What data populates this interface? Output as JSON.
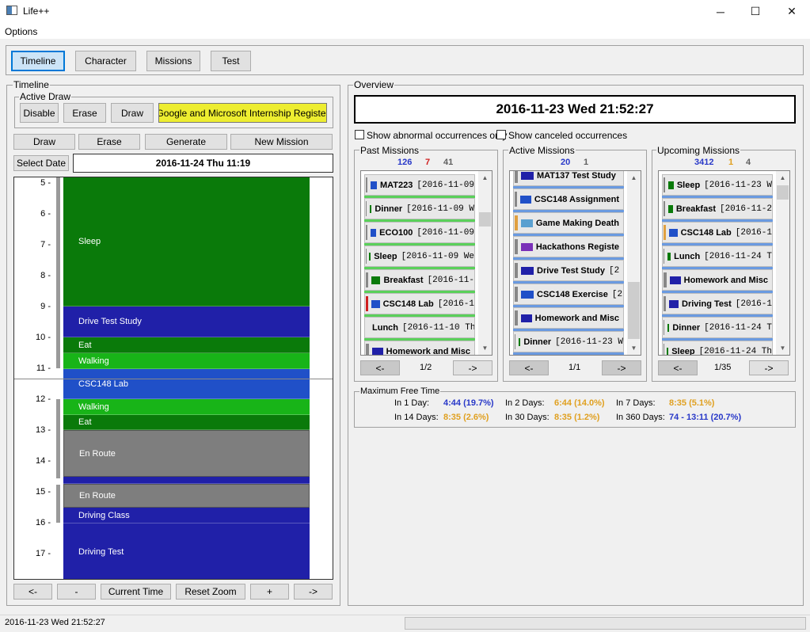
{
  "window": {
    "title": "Life++",
    "minimize": "─",
    "maximize": "☐",
    "close": "✕"
  },
  "menu": {
    "options": "Options"
  },
  "tabs": [
    "Timeline",
    "Character",
    "Missions",
    "Test"
  ],
  "timeline": {
    "group_label": "Timeline",
    "active_draw": {
      "label": "Active Draw",
      "disable": "Disable",
      "erase": "Erase",
      "draw": "Draw",
      "current_mission": "Google and Microsoft Internship Register"
    },
    "toolbar": {
      "draw": "Draw",
      "erase": "Erase",
      "generate": "Generate",
      "new_mission": "New Mission"
    },
    "select_date": "Select Date",
    "date_display": "2016-11-24 Thu 11:19",
    "hours": [
      "5 -",
      "6 -",
      "7 -",
      "8 -",
      "9 -",
      "10 -",
      "11 -",
      "12 -",
      "13 -",
      "14 -",
      "15 -",
      "16 -",
      "17 -"
    ],
    "blocks": [
      {
        "label": "Sleep",
        "color": "#0a7a0a"
      },
      {
        "label": "Drive Test Study",
        "color": "#2020a8"
      },
      {
        "label": "Eat",
        "color": "#0a7a0a"
      },
      {
        "label": "Walking",
        "color": "#18b418"
      },
      {
        "label": "CSC148 Lab",
        "color": "#2050c8"
      },
      {
        "label": "Walking",
        "color": "#18b418"
      },
      {
        "label": "Eat",
        "color": "#0a7a0a"
      },
      {
        "label": "En Route",
        "color": "#7e7e7e"
      },
      {
        "label": "",
        "color": "#2020a8"
      },
      {
        "label": "En Route",
        "color": "#7e7e7e"
      },
      {
        "label": "Driving Class",
        "color": "#2020a8"
      },
      {
        "label": "Driving Test",
        "color": "#2020a8"
      }
    ],
    "nav": {
      "prev": "<-",
      "zoom_out": "-",
      "current_time": "Current Time",
      "reset_zoom": "Reset Zoom",
      "zoom_in": "+",
      "next": "->"
    }
  },
  "overview": {
    "group_label": "Overview",
    "datetime": "2016-11-23 Wed 21:52:27",
    "show_abnormal": "Show abnormal occurrences only",
    "show_canceled": "Show canceled occurrences",
    "past": {
      "label": "Past Missions",
      "counts": [
        "126",
        "7",
        "41"
      ],
      "page": "1/2",
      "prev": "<-",
      "next": "->",
      "items": [
        {
          "name": "MAT223",
          "date": "[2016-11-09",
          "color": "#2050c8",
          "bar": "#888888",
          "progress": "#5ad05a"
        },
        {
          "name": "Dinner",
          "date": "[2016-11-09 W",
          "color": "#0a7a0a",
          "bar": "#888888",
          "progress": "#5ad05a"
        },
        {
          "name": "ECO100",
          "date": "[2016-11-09",
          "color": "#2050c8",
          "bar": "#888888",
          "progress": "#5ad05a"
        },
        {
          "name": "Sleep",
          "date": "[2016-11-09 We",
          "color": "#0a7a0a",
          "bar": "#888888",
          "progress": "#5ad05a"
        },
        {
          "name": "Breakfast",
          "date": "[2016-11-",
          "color": "#0a7a0a",
          "bar": "#888888",
          "progress": "#5ad05a"
        },
        {
          "name": "CSC148 Lab",
          "date": "[2016-1",
          "color": "#2050c8",
          "bar": "#d02020",
          "progress": "#5ad05a"
        },
        {
          "name": "Lunch",
          "date": "[2016-11-10 Th",
          "color": "#0a7a0a",
          "bar": "#888888",
          "progress": "#5ad05a"
        },
        {
          "name": "Homework and Misc",
          "date": "",
          "color": "#2020a8",
          "bar": "#888888",
          "progress": "#5ad05a"
        }
      ]
    },
    "active": {
      "label": "Active Missions",
      "counts": [
        "20",
        "1"
      ],
      "page": "1/1",
      "prev": "<-",
      "next": "->",
      "items": [
        {
          "name": "MAT137 Test Study",
          "date": "",
          "color": "#2020a8",
          "bar": "#888888",
          "progress": "#6a9ae0"
        },
        {
          "name": "CSC148 Assignment",
          "date": "",
          "color": "#2050c8",
          "bar": "#888888",
          "progress": "#6a9ae0"
        },
        {
          "name": "Game Making Death",
          "date": "",
          "color": "#5aa0d0",
          "bar": "#e0a040",
          "progress": "#6a9ae0"
        },
        {
          "name": "Hackathons Registe",
          "date": "",
          "color": "#7a30b8",
          "bar": "#888888",
          "progress": "#6a9ae0"
        },
        {
          "name": "Drive Test Study",
          "date": "[2",
          "color": "#2020a8",
          "bar": "#888888",
          "progress": "#6a9ae0"
        },
        {
          "name": "CSC148 Exercise",
          "date": "[2",
          "color": "#2050c8",
          "bar": "#888888",
          "progress": "#6a9ae0"
        },
        {
          "name": "Homework and Misc",
          "date": "",
          "color": "#2020a8",
          "bar": "#888888",
          "progress": "#6a9ae0"
        },
        {
          "name": "Dinner",
          "date": "[2016-11-23 W",
          "color": "#0a7a0a",
          "bar": "#888888",
          "progress": "#6a9ae0"
        }
      ]
    },
    "upcoming": {
      "label": "Upcoming Missions",
      "counts": [
        "3412",
        "1",
        "4"
      ],
      "page": "1/35",
      "prev": "<-",
      "next": "->",
      "items": [
        {
          "name": "Sleep",
          "date": "[2016-11-23 W",
          "color": "#0a7a0a",
          "bar": "#888888",
          "progress": "#6a9ae0"
        },
        {
          "name": "Breakfast",
          "date": "[2016-11-2",
          "color": "#0a7a0a",
          "bar": "#888888",
          "progress": "#6a9ae0"
        },
        {
          "name": "CSC148 Lab",
          "date": "[2016-1",
          "color": "#2050c8",
          "bar": "#e0a040",
          "progress": "#6a9ae0"
        },
        {
          "name": "Lunch",
          "date": "[2016-11-24 T",
          "color": "#0a7a0a",
          "bar": "#888888",
          "progress": "#6a9ae0"
        },
        {
          "name": "Homework and Misc",
          "date": "",
          "color": "#2020a8",
          "bar": "#888888",
          "progress": "#6a9ae0"
        },
        {
          "name": "Driving Test",
          "date": "[2016-1",
          "color": "#2020a8",
          "bar": "#888888",
          "progress": "#6a9ae0"
        },
        {
          "name": "Dinner",
          "date": "[2016-11-24 T",
          "color": "#0a7a0a",
          "bar": "#888888",
          "progress": "#6a9ae0"
        },
        {
          "name": "Sleep",
          "date": "[2016-11-24 Th",
          "color": "#0a7a0a",
          "bar": "#888888",
          "progress": "#6a9ae0"
        }
      ]
    },
    "free_time": {
      "label": "Maximum Free Time",
      "rows": [
        {
          "label": "In 1 Day:",
          "value": "4:44 (19.7%)",
          "color": "#2838c8"
        },
        {
          "label": "In 2 Days:",
          "value": "6:44 (14.0%)",
          "color": "#e0a020"
        },
        {
          "label": "In 7 Days:",
          "value": "8:35 (5.1%)",
          "color": "#e0a020"
        },
        {
          "label": "In 14 Days:",
          "value": "8:35 (2.6%)",
          "color": "#e0a020"
        },
        {
          "label": "In 30 Days:",
          "value": "8:35 (1.2%)",
          "color": "#e0a020"
        },
        {
          "label": "In 360 Days:",
          "value": "74 - 13:11 (20.7%)",
          "color": "#2838c8"
        }
      ]
    }
  },
  "status": {
    "text": "2016-11-23 Wed 21:52:27"
  },
  "colors": {
    "blue_count": "#2838c8",
    "red_count": "#d02020",
    "gray_count": "#606060",
    "orange_count": "#e0a020"
  }
}
